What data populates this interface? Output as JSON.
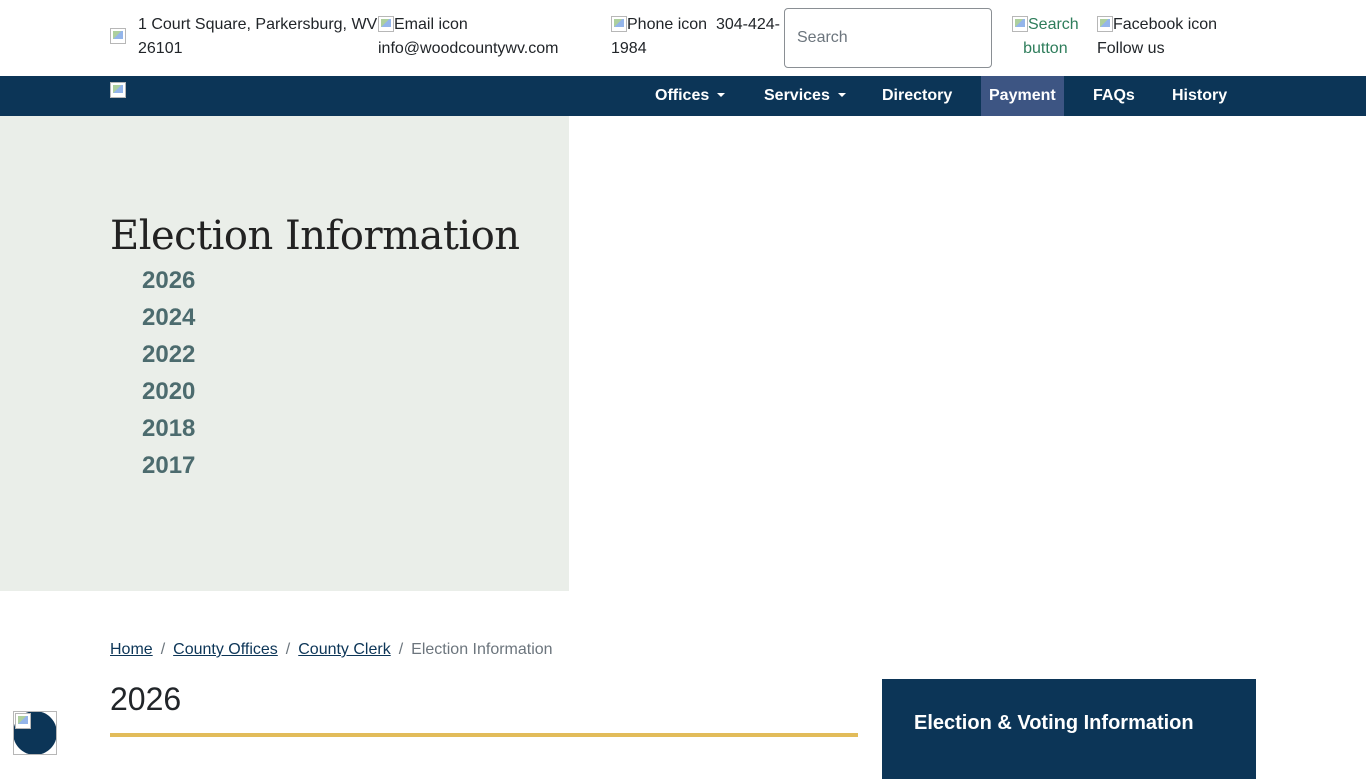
{
  "topbar": {
    "address_line1": "1 Court Square, Parkersburg, WV",
    "address_line2": "26101",
    "email_icon_alt": "Email icon",
    "email": "info@woodcountywv.com",
    "phone_icon_alt": "Phone icon",
    "phone_part1": "304-424-",
    "phone_part2": "1984",
    "search_placeholder": "Search",
    "search_button_line1": "Search",
    "search_button_line2": "button",
    "facebook_icon_alt": "Facebook icon",
    "follow_us": "Follow us"
  },
  "nav": {
    "items": [
      {
        "label": "Offices"
      },
      {
        "label": "Services"
      },
      {
        "label": "Directory"
      },
      {
        "label": "Payment"
      },
      {
        "label": "FAQs"
      },
      {
        "label": "History"
      }
    ]
  },
  "hero": {
    "title": "Election Information",
    "years": [
      "2026",
      "2024",
      "2022",
      "2020",
      "2018",
      "2017"
    ]
  },
  "breadcrumb": {
    "items": [
      "Home",
      "County Offices",
      "County Clerk"
    ],
    "current": "Election Information"
  },
  "main": {
    "heading": "2026"
  },
  "sidebar": {
    "title": "Election & Voting Information"
  },
  "colors": {
    "navy": "#0c3557",
    "active_nav": "#3d5583",
    "hero_panel": "#eaeee9",
    "gold_rule": "#e2bc5a",
    "year_link": "#4c6b6e"
  }
}
